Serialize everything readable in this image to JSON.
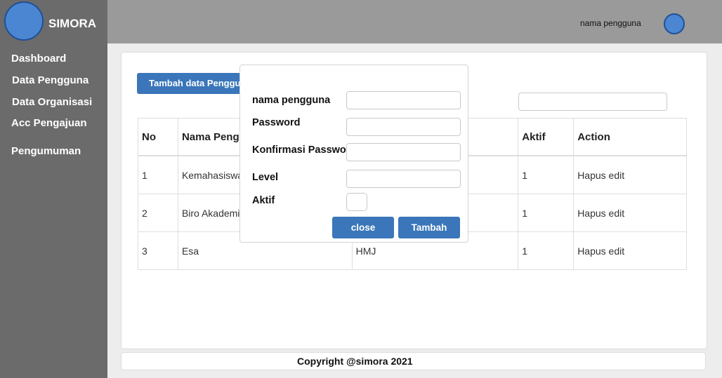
{
  "app": {
    "brand": "SIMORA"
  },
  "sidebar": {
    "items": [
      {
        "label": "Dashboard"
      },
      {
        "label": "Data Pengguna"
      },
      {
        "label": "Data Organisasi"
      },
      {
        "label": "Acc Pengajuan"
      },
      {
        "label": "Pengumuman"
      }
    ]
  },
  "header": {
    "user_name": "nama pengguna"
  },
  "main": {
    "add_button_label": "Tambah data Pengguna",
    "search": {
      "value": "",
      "placeholder": ""
    },
    "table": {
      "headers": [
        "No",
        "Nama Pengguna",
        "Level",
        "Aktif",
        "Action"
      ],
      "rows": [
        [
          "1",
          "Kemahasiswaan",
          "",
          "1",
          "Hapus edit"
        ],
        [
          "2",
          "Biro Akademik",
          "",
          "1",
          "Hapus edit"
        ],
        [
          "3",
          "Esa",
          "HMJ",
          "1",
          "Hapus edit"
        ]
      ]
    }
  },
  "modal": {
    "fields": [
      {
        "label": "nama pengguna",
        "value": ""
      },
      {
        "label": "Password",
        "value": ""
      },
      {
        "label": "Konfirmasi Password",
        "value": ""
      },
      {
        "label": "Level",
        "value": ""
      }
    ],
    "aktif_label": "Aktif",
    "close_label": "close",
    "submit_label": "Tambah"
  },
  "footer": {
    "text": "Copyright @simora 2021"
  },
  "colors": {
    "accent": "#3a76b9",
    "sidebar": "#6b6b6b",
    "header": "#9a9a9a",
    "avatar": "#4a86d2"
  }
}
